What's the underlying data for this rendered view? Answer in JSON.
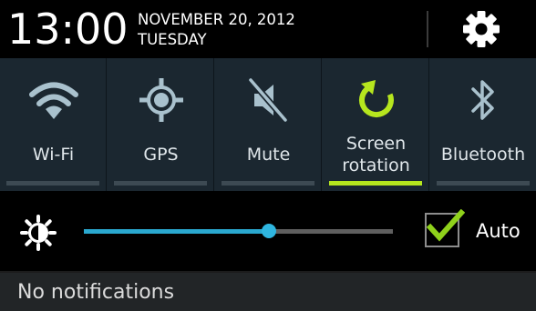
{
  "header": {
    "time": "13:00",
    "date": "NOVEMBER 20, 2012",
    "day": "TUESDAY",
    "settings_icon": "gear-icon"
  },
  "toggles": [
    {
      "label": "Wi-Fi",
      "icon": "wifi-icon",
      "on": false
    },
    {
      "label": "GPS",
      "icon": "gps-icon",
      "on": false
    },
    {
      "label": "Mute",
      "icon": "mute-icon",
      "on": false
    },
    {
      "label": "Screen\nrotation",
      "icon": "rotation-icon",
      "on": true
    },
    {
      "label": "Bluetooth",
      "icon": "bluetooth-icon",
      "on": false
    }
  ],
  "brightness": {
    "icon": "brightness-icon",
    "level_percent": 60,
    "auto_label": "Auto",
    "auto_checked": true
  },
  "notifications": {
    "empty_text": "No notifications"
  },
  "colors": {
    "toggle_background": "#1b2730",
    "active_indicator": "#b6e61e",
    "inactive_indicator": "#3d4a53",
    "slider_fill": "#2aa8cf",
    "check_mark": "#8fd11b",
    "icon_inactive": "#a9c1cd"
  }
}
